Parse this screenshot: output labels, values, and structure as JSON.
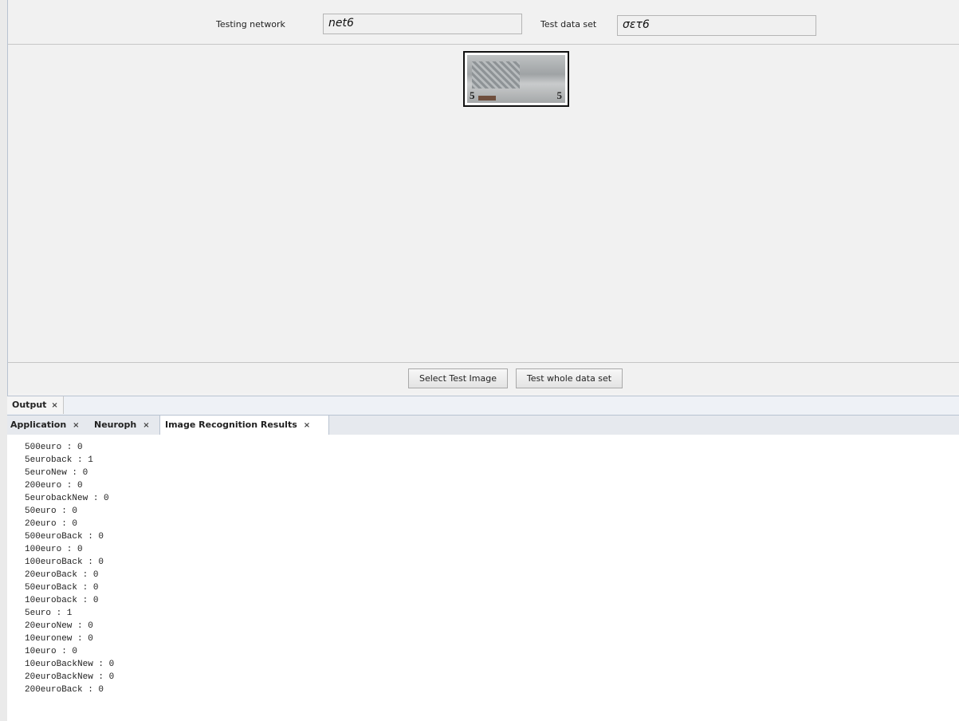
{
  "top": {
    "testing_network_label": "Testing network",
    "testing_network_value": "net6",
    "test_data_set_label": "Test data set",
    "test_data_set_value": "σετ6"
  },
  "preview": {
    "note_left": "5",
    "note_right": "5"
  },
  "buttons": {
    "select_test_image": "Select Test Image",
    "test_whole_data_set": "Test whole data set"
  },
  "output_panel": {
    "title": "Output",
    "close": "×"
  },
  "tabs": [
    {
      "label": "Application",
      "close": "×"
    },
    {
      "label": "Neuroph",
      "close": "×"
    },
    {
      "label": "Image Recognition Results",
      "close": "×"
    }
  ],
  "results": [
    "500euro : 0",
    "5euroback : 1",
    "5euroNew : 0",
    "200euro : 0",
    "5eurobackNew : 0",
    "50euro : 0",
    "20euro : 0",
    "500euroBack : 0",
    "100euro : 0",
    "100euroBack : 0",
    "20euroBack : 0",
    "50euroBack : 0",
    "10euroback : 0",
    "5euro : 1",
    "20euroNew : 0",
    "10euronew : 0",
    "10euro : 0",
    "10euroBackNew : 0",
    "20euroBackNew : 0",
    "200euroBack : 0"
  ]
}
